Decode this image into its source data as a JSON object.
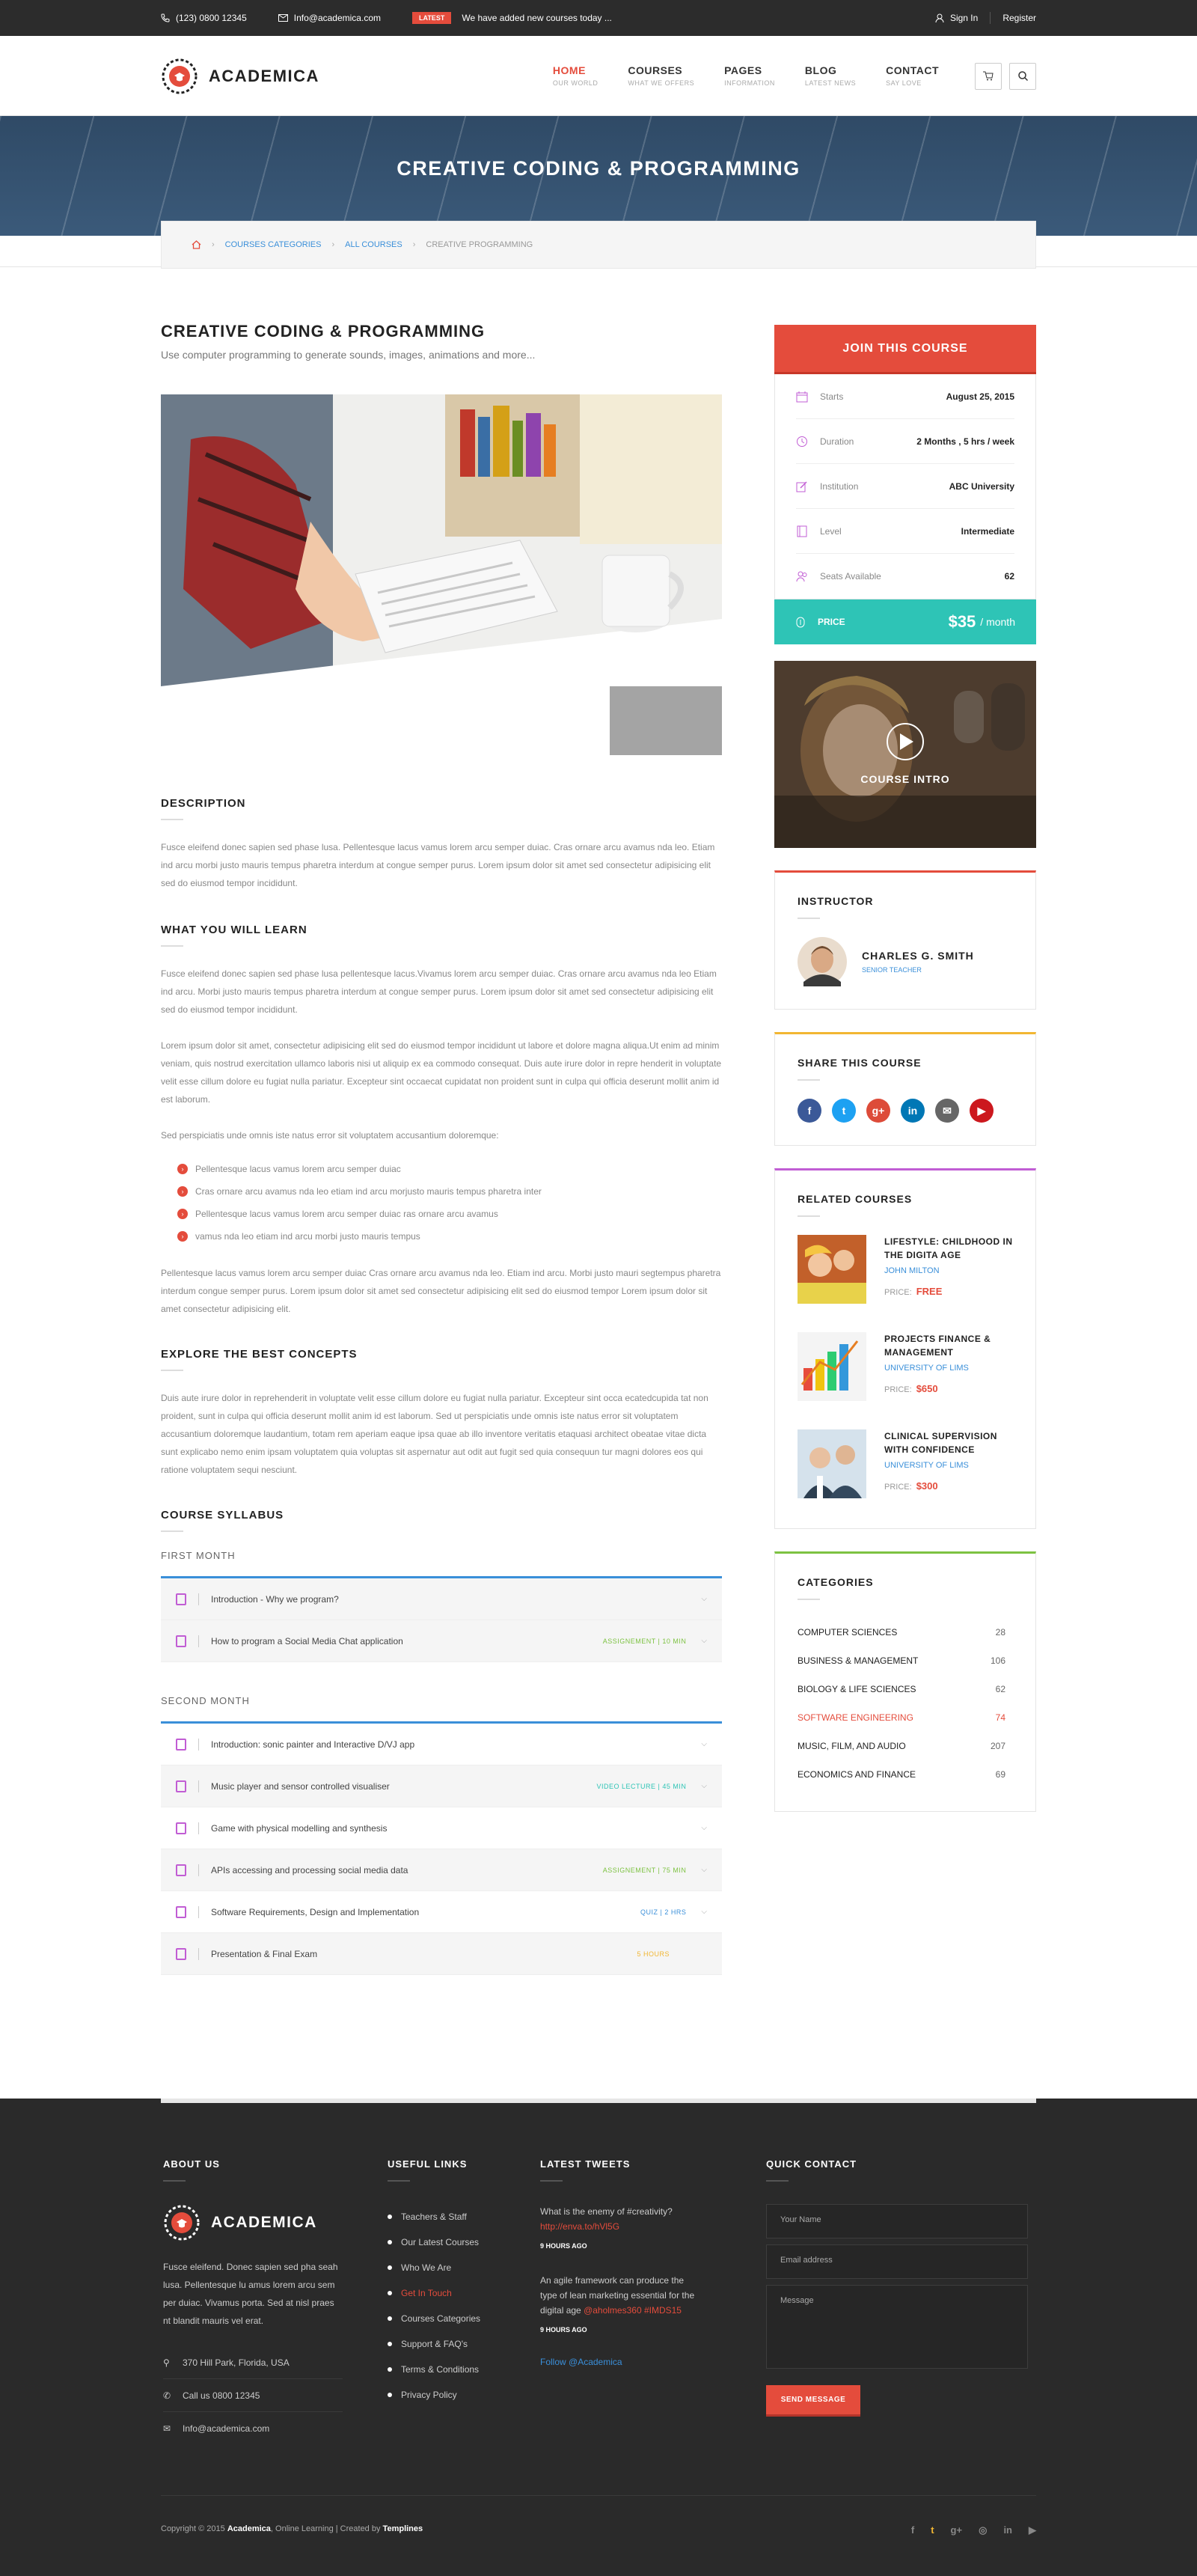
{
  "topbar": {
    "phone": "(123) 0800 12345",
    "email": "Info@academica.com",
    "latest_badge": "LATEST",
    "news": "We have added new courses today ...",
    "signin": "Sign In",
    "register": "Register"
  },
  "header": {
    "logo": "ACADEMICA",
    "nav": [
      {
        "title": "HOME",
        "sub": "OUR WORLD"
      },
      {
        "title": "COURSES",
        "sub": "WHAT WE OFFERS"
      },
      {
        "title": "PAGES",
        "sub": "INFORMATION"
      },
      {
        "title": "BLOG",
        "sub": "LATEST NEWS"
      },
      {
        "title": "CONTACT",
        "sub": "SAY LOVE"
      }
    ]
  },
  "hero": {
    "title": "CREATIVE CODING & PROGRAMMING",
    "breadcrumb": [
      "COURSES CATEGORIES",
      "ALL COURSES",
      "CREATIVE PROGRAMMING"
    ]
  },
  "course": {
    "title": "CREATIVE CODING & PROGRAMMING",
    "subtitle": "Use computer programming to generate sounds, images, animations and more...",
    "description_h": "DESCRIPTION",
    "description": "Fusce eleifend donec sapien sed phase lusa. Pellentesque lacus vamus lorem arcu semper duiac. Cras ornare arcu avamus nda leo. Etiam ind arcu morbi justo mauris tempus pharetra interdum at congue semper purus. Lorem ipsum dolor sit amet sed consectetur adipisicing elit sed do eiusmod tempor incididunt.",
    "learn_h": "WHAT YOU WILL LEARN",
    "learn_p1": "Fusce eleifend donec sapien sed phase lusa pellentesque lacus.Vivamus lorem arcu semper duiac. Cras ornare arcu avamus nda leo Etiam ind arcu. Morbi justo mauris tempus pharetra interdum at congue semper purus. Lorem ipsum dolor sit amet sed consectetur adipisicing elit sed do eiusmod tempor incididunt.",
    "learn_p2": "Lorem ipsum dolor sit amet, consectetur adipisicing elit sed do eiusmod tempor incididunt ut labore et dolore magna aliqua.Ut enim ad minim veniam, quis nostrud exercitation ullamco laboris nisi ut aliquip ex ea commodo consequat. Duis aute irure dolor in repre henderit in voluptate velit esse cillum dolore eu fugiat nulla pariatur. Excepteur sint occaecat cupidatat non proident sunt in culpa qui officia deserunt mollit anim id est laborum.",
    "learn_p3": "Sed perspiciatis unde omnis iste natus error sit voluptatem accusantium doloremque:",
    "bullets": [
      "Pellentesque lacus vamus lorem arcu semper duiac",
      "Cras ornare arcu avamus nda leo etiam ind arcu morjusto mauris tempus pharetra inter",
      "Pellentesque lacus vamus lorem arcu semper duiac ras ornare arcu avamus",
      "vamus nda leo etiam ind arcu morbi justo mauris tempus"
    ],
    "learn_p4": "Pellentesque lacus vamus lorem arcu semper duiac Cras ornare arcu avamus nda leo. Etiam ind arcu. Morbi justo mauri segtempus pharetra interdum congue semper purus. Lorem ipsum dolor sit amet sed consectetur adipisicing elit sed do eiusmod tempor Lorem ipsum dolor sit amet consectetur adipisicing elit.",
    "explore_h": "EXPLORE THE BEST CONCEPTS",
    "explore_p": "Duis aute irure dolor in reprehenderit in voluptate velit esse cillum dolore eu fugiat nulla pariatur. Excepteur sint occa ecatedcupida tat non proident, sunt in culpa qui officia deserunt mollit anim id est laborum. Sed ut perspiciatis unde omnis iste natus error sit voluptatem accusantium doloremque laudantium, totam rem aperiam eaque ipsa quae ab illo inventore veritatis etaquasi architect obeatae vitae dicta sunt explicabo nemo enim ipsam voluptatem quia voluptas sit aspernatur aut odit aut fugit sed quia consequun tur magni dolores eos qui ratione voluptatem sequi nesciunt.",
    "syllabus_h": "COURSE SYLLABUS",
    "month1": "FIRST MONTH",
    "month1_rows": [
      {
        "title": "Introduction - Why we program?",
        "tag": "",
        "tag_color": ""
      },
      {
        "title": "How to program a Social Media Chat application",
        "tag": "ASSIGNEMENT | 10 MIN",
        "tag_color": "#7dc242"
      }
    ],
    "month2": "SECOND MONTH",
    "month2_rows": [
      {
        "title": "Introduction: sonic painter and Interactive D/VJ app",
        "tag": "",
        "tag_color": ""
      },
      {
        "title": "Music player and sensor controlled visualiser",
        "tag": "VIDEO LECTURE | 45 MIN",
        "tag_color": "#2ec4b6"
      },
      {
        "title": "Game with physical modelling and synthesis",
        "tag": "",
        "tag_color": ""
      },
      {
        "title": "APIs accessing and processing social media data",
        "tag": "ASSIGNEMENT | 75 MIN",
        "tag_color": "#7dc242"
      },
      {
        "title": "Software Requirements, Design and Implementation",
        "tag": "QUIZ | 2 HRS",
        "tag_color": "#3a8fd9"
      },
      {
        "title": "Presentation & Final Exam",
        "tag": "5 HOURS",
        "tag_color": "#f2b632"
      }
    ]
  },
  "sidebar": {
    "join": "JOIN THIS COURSE",
    "info": [
      {
        "label": "Starts",
        "value": "August 25, 2015"
      },
      {
        "label": "Duration",
        "value": "2 Months , 5 hrs / week"
      },
      {
        "label": "Institution",
        "value": "ABC University"
      },
      {
        "label": "Level",
        "value": "Intermediate"
      },
      {
        "label": "Seats Available",
        "value": "62"
      }
    ],
    "price_label": "PRICE",
    "price": "$35",
    "price_per": "/ month",
    "video_label": "COURSE INTRO",
    "instructor_h": "INSTRUCTOR",
    "instructor_name": "CHARLES G. SMITH",
    "instructor_role": "SENIOR TEACHER",
    "share_h": "SHARE THIS COURSE",
    "social": [
      {
        "icon": "f",
        "name": "facebook-icon",
        "color": "#3b5998"
      },
      {
        "icon": "t",
        "name": "twitter-icon",
        "color": "#1da1f2"
      },
      {
        "icon": "g+",
        "name": "google-plus-icon",
        "color": "#dd4b39"
      },
      {
        "icon": "in",
        "name": "linkedin-icon",
        "color": "#0077b5"
      },
      {
        "icon": "✉",
        "name": "mail-icon",
        "color": "#666666"
      },
      {
        "icon": "▶",
        "name": "youtube-icon",
        "color": "#cc181e"
      }
    ],
    "related_h": "RELATED COURSES",
    "related": [
      {
        "title": "LIFESTYLE: CHILDHOOD IN THE DIGITA AGE",
        "author": "JOHN MILTON",
        "price_label": "PRICE:",
        "price": "FREE"
      },
      {
        "title": "PROJECTS FINANCE & MANAGEMENT",
        "author": "UNIVERSITY OF LIMS",
        "price_label": "PRICE:",
        "price": "$650"
      },
      {
        "title": "CLINICAL SUPERVISION WITH CONFIDENCE",
        "author": "UNIVERSITY OF LIMS",
        "price_label": "PRICE:",
        "price": "$300"
      }
    ],
    "categories_h": "CATEGORIES",
    "categories": [
      {
        "name": "COMPUTER SCIENCES",
        "count": "28"
      },
      {
        "name": "BUSINESS & MANAGEMENT",
        "count": "106"
      },
      {
        "name": "BIOLOGY & LIFE SCIENCES",
        "count": "62"
      },
      {
        "name": "SOFTWARE ENGINEERING",
        "count": "74"
      },
      {
        "name": "MUSIC, FILM, AND AUDIO",
        "count": "207"
      },
      {
        "name": "ECONOMICS AND FINANCE",
        "count": "69"
      }
    ]
  },
  "footer": {
    "about_h": "ABOUT US",
    "logo": "ACADEMICA",
    "about_text": "Fusce eleifend. Donec sapien sed pha seah lusa. Pellentesque lu amus lorem arcu sem per duiac. Vivamus porta. Sed at nisl praes nt blandit mauris vel erat.",
    "address": "370 Hill Park, Florida, USA",
    "phone": "Call us 0800 12345",
    "email": "Info@academica.com",
    "links_h": "USEFUL LINKS",
    "links": [
      "Teachers & Staff",
      "Our Latest Courses",
      "Who We Are",
      "Get In Touch",
      "Courses Categories",
      "Support & FAQ's",
      "Terms & Conditions",
      "Privacy Policy"
    ],
    "tweets_h": "LATEST TWEETS",
    "tweet1": "What is the enemy of #creativity?",
    "tweet1_link": "http://enva.to/hVl5G",
    "tweet1_ago": "9 HOURS AGO",
    "tweet2": "An agile framework can produce the type of lean marketing essential for the digital age",
    "tweet2_link": "@aholmes360 #IMDS15",
    "tweet2_ago": "9 HOURS AGO",
    "follow": "Follow @Academica",
    "contact_h": "QUICK CONTACT",
    "name_ph": "Your Name",
    "email_ph": "Email address",
    "msg_ph": "Message",
    "send": "SEND MESSAGE",
    "copy1": "Copyright © 2015 ",
    "copy_brand": "Academica",
    "copy2": ", Online Learning  |  Created by ",
    "copy_author": "Templines",
    "social": [
      "f",
      "t",
      "g+",
      "◎",
      "in",
      "▶"
    ]
  }
}
